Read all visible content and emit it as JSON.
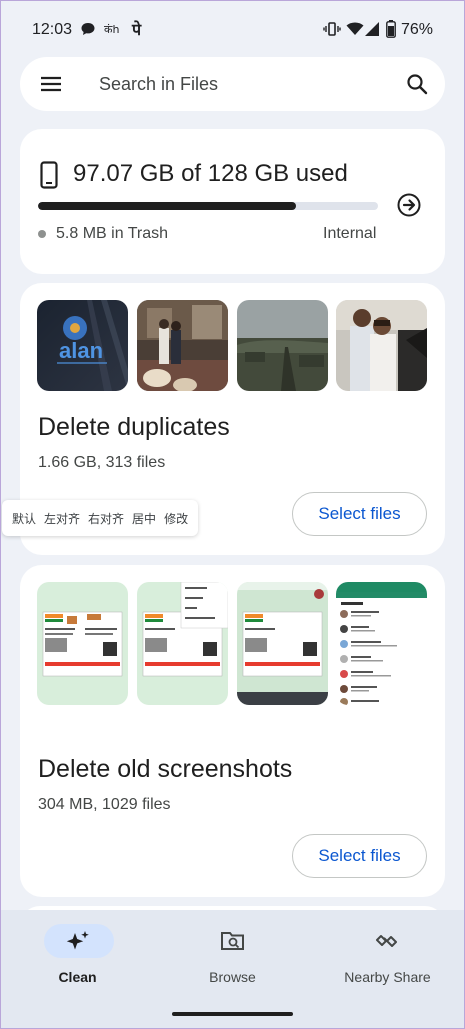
{
  "status_bar": {
    "time": "12:03",
    "extra_icons": [
      "chat-bubble-icon",
      "hindi-keyboard-icon",
      "hindi-char-icon"
    ],
    "right_icons": [
      "vibrate-icon",
      "wifi-icon",
      "signal-icon",
      "battery-icon"
    ],
    "battery": "76%"
  },
  "search": {
    "placeholder": "Search in Files"
  },
  "storage": {
    "used_text": "97.07 GB of 128 GB used",
    "used_fraction": 0.7583,
    "trash_text": "5.8 MB in Trash",
    "location": "Internal"
  },
  "duplicates": {
    "title": "Delete duplicates",
    "subtitle": "1.66 GB, 313 files",
    "button": "Select files",
    "thumbnails": [
      "alan-logo-photo",
      "couple-event-photo",
      "landscape-road-photo",
      "couple-portrait-photo"
    ]
  },
  "screenshots": {
    "title": "Delete old screenshots",
    "subtitle": "304 MB, 1029 files",
    "button": "Select files",
    "thumbnails": [
      "document-screenshot",
      "document-menu-screenshot",
      "document-viewer-screenshot",
      "whatsapp-archived-screenshot"
    ]
  },
  "tooltip": {
    "items": [
      "默认",
      "左对齐",
      "右对齐",
      "居中",
      "修改"
    ]
  },
  "bottom_nav": {
    "items": [
      {
        "label": "Clean",
        "icon": "sparkle-icon",
        "active": true
      },
      {
        "label": "Browse",
        "icon": "browse-folder-icon",
        "active": false
      },
      {
        "label": "Nearby Share",
        "icon": "nearby-share-icon",
        "active": false
      }
    ]
  },
  "colors": {
    "background": "#eef1f7",
    "accent": "#0b57d0",
    "active_pill": "#d3e3fd"
  }
}
